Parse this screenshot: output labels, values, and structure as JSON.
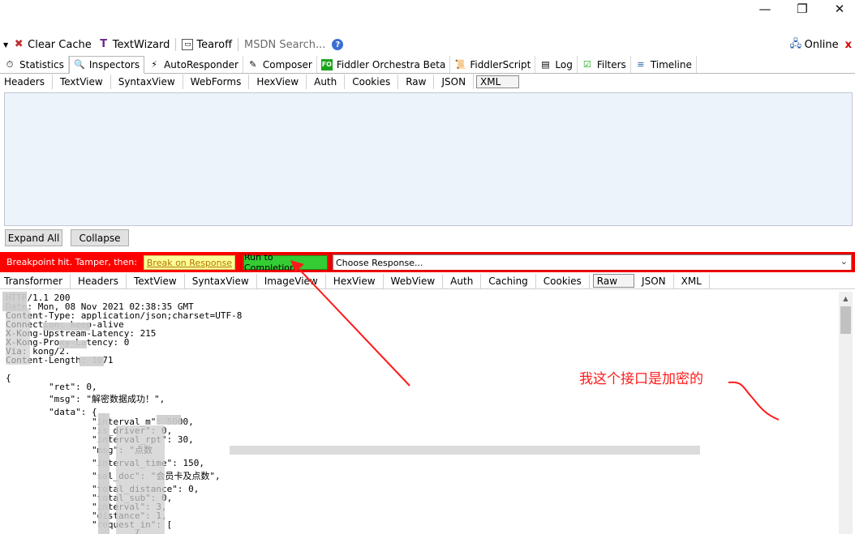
{
  "window": {
    "minimize_glyph": "—",
    "restore_glyph": "❐",
    "close_glyph": "✕"
  },
  "toolbar": {
    "clear_cache_label": "Clear Cache",
    "textwizard_label": "TextWizard",
    "tearoff_label": "Tearoff",
    "search_placeholder": "MSDN Search...",
    "online_label": "Online",
    "close_glyph": "x"
  },
  "main_tabs": [
    {
      "label": "Statistics",
      "icon": "stopwatch-icon"
    },
    {
      "label": "Inspectors",
      "icon": "magnifier-icon"
    },
    {
      "label": "AutoResponder",
      "icon": "lightning-icon"
    },
    {
      "label": "Composer",
      "icon": "composer-icon"
    },
    {
      "label": "Fiddler Orchestra Beta",
      "icon": "fo-icon",
      "badge": "FO"
    },
    {
      "label": "FiddlerScript",
      "icon": "script-icon"
    },
    {
      "label": "Log",
      "icon": "log-icon"
    },
    {
      "label": "Filters",
      "icon": "checkbox-icon"
    },
    {
      "label": "Timeline",
      "icon": "timeline-icon"
    }
  ],
  "request_tabs": [
    "Headers",
    "TextView",
    "SyntaxView",
    "WebForms",
    "HexView",
    "Auth",
    "Cookies",
    "Raw",
    "JSON",
    "XML"
  ],
  "request_buttons": {
    "expand_all": "Expand All",
    "collapse": "Collapse"
  },
  "breakpoint": {
    "label": "Breakpoint hit. Tamper, then:",
    "break_on_response": "Break on Response",
    "run_to_completion": "Run to Completion",
    "choose_response": "Choose Response..."
  },
  "response_tabs": [
    "Transformer",
    "Headers",
    "TextView",
    "SyntaxView",
    "ImageView",
    "HexView",
    "WebView",
    "Auth",
    "Caching",
    "Cookies",
    "Raw",
    "JSON",
    "XML"
  ],
  "response_lines": [
    "HTTP/1.1 200",
    "Date: Mon, 08 Nov 2021 02:38:35 GMT",
    "Content-Type: application/json;charset=UTF-8",
    "Connection: keep-alive",
    "X-Kong-Upstream-Latency: 215",
    "X-Kong-Proxy-Latency: 0",
    "Via: kong/2.",
    "Content-Length: 1071",
    "",
    "{",
    "        \"ret\": 0,",
    "        \"msg\": \"解密数据成功！\",",
    "        \"data\": {",
    "                \"interval_m\": 5000,",
    "                \"is_driver\": 0,",
    "                \"interval_rpt\": 30,",
    "                \"msg\": \"点数",
    "                \"interval_time\": 150,",
    "                \"sel_doc\": \"会员卡及点数\",",
    "                \"total_distance\": 0,",
    "                \"total_sub\": 0,",
    "                \"interval\": 3,",
    "                \"distance\": 1,",
    "                \"request_in\": [",
    "                        {"
  ],
  "annotation": {
    "text": "我这个接口是加密的"
  },
  "colors": {
    "breakpoint_bar": "#ff0000",
    "break_button": "#ffff9a",
    "run_button": "#33cc33",
    "annotation": "#ff1a1a"
  }
}
